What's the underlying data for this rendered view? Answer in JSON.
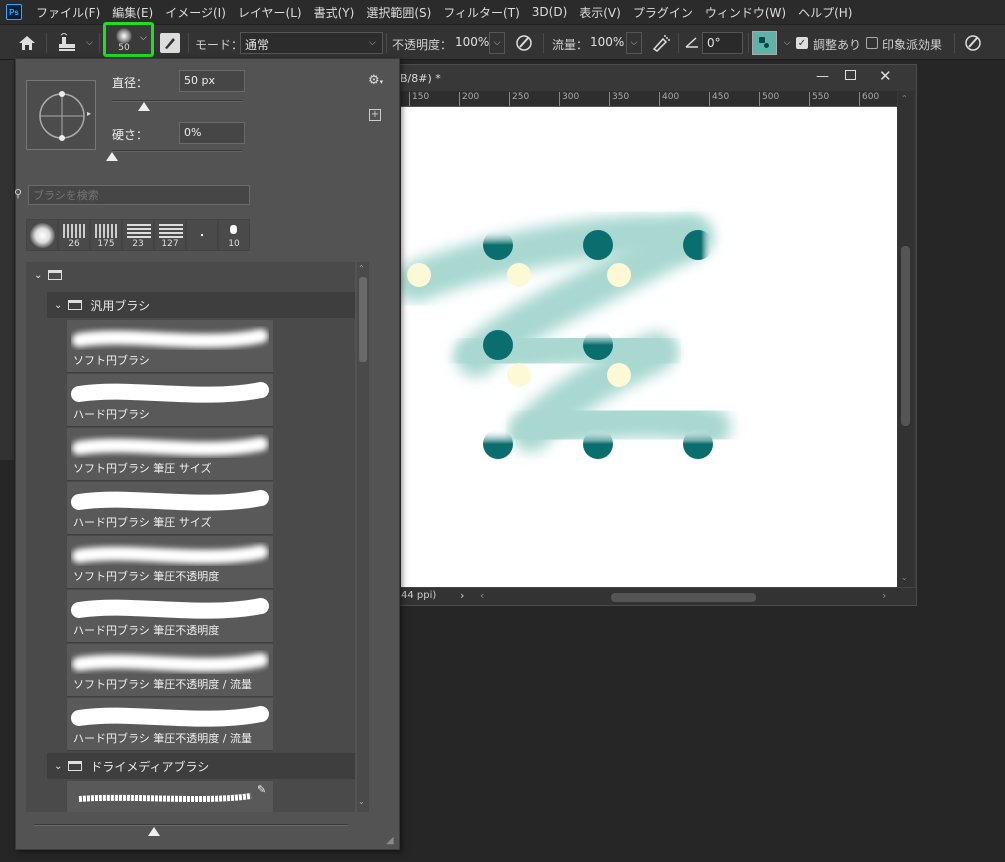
{
  "app_logo": "Ps",
  "menu": [
    "ファイル(F)",
    "編集(E)",
    "イメージ(I)",
    "レイヤー(L)",
    "書式(Y)",
    "選択範囲(S)",
    "フィルター(T)",
    "3D(D)",
    "表示(V)",
    "プラグイン",
    "ウィンドウ(W)",
    "ヘルプ(H)"
  ],
  "options": {
    "brush_size": "50",
    "mode_label": "モード：",
    "mode_value": "通常",
    "opacity_label": "不透明度：",
    "opacity_value": "100%",
    "flow_label": "流量：",
    "flow_value": "100%",
    "angle_value": "0°",
    "adjust_label": "調整あり",
    "impressionist_label": "印象派効果",
    "highlight_color": "#22dd22",
    "swatch_color": "#5fb3a6"
  },
  "document": {
    "title": "B/8#) *",
    "ruler_ticks": [
      "150",
      "200",
      "250",
      "300",
      "350",
      "400",
      "450",
      "500",
      "550",
      "600"
    ],
    "status_text": "44 ppi)",
    "stroke_color": "#a8d8d0",
    "dark_dot_color": "#0a6e6e",
    "light_dot_color": "#fdf8d6"
  },
  "brush_panel": {
    "diameter_label": "直径：",
    "diameter_value": "50 px",
    "hardness_label": "硬さ：",
    "hardness_value": "0%",
    "search_placeholder": "ブラシを検索",
    "recent_brushes": [
      "",
      "26",
      "175",
      "23",
      "127",
      "",
      "10"
    ],
    "group_general": "汎用ブラシ",
    "brushes": [
      "ソフト円ブラシ",
      "ハード円ブラシ",
      "ソフト円ブラシ 筆圧 サイズ",
      "ハード円ブラシ 筆圧 サイズ",
      "ソフト円ブラシ 筆圧不透明度",
      "ハード円ブラシ 筆圧不透明度",
      "ソフト円ブラシ 筆圧不透明度 / 流量",
      "ハード円ブラシ 筆圧不透明度 / 流量"
    ],
    "group_dry": "ドライメディアブラシ"
  }
}
